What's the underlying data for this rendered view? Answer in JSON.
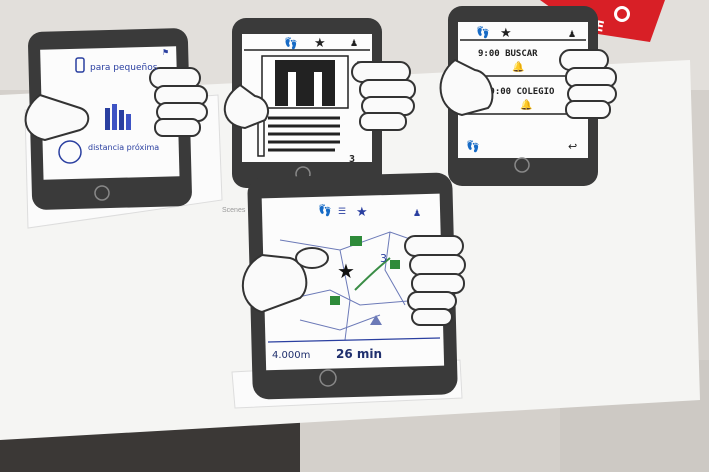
{
  "table_label": "Scenes",
  "badge_text": "3",
  "phones": {
    "menu": {
      "item1": "para pequeños",
      "item2": "distancia próxima"
    },
    "alarms": {
      "alarm1": "9:00 BUSCAR",
      "alarm2": "10:00 COLEGIO"
    },
    "map": {
      "distance": "4.000m",
      "time": "26 min"
    }
  },
  "colors": {
    "background": "#cfcbc6",
    "board": "#f4f4f2",
    "phone_body": "#3a3a3a",
    "ink_blue": "#2a3fa0",
    "ink_green": "#2e8b3a",
    "red_card": "#d81f26"
  }
}
